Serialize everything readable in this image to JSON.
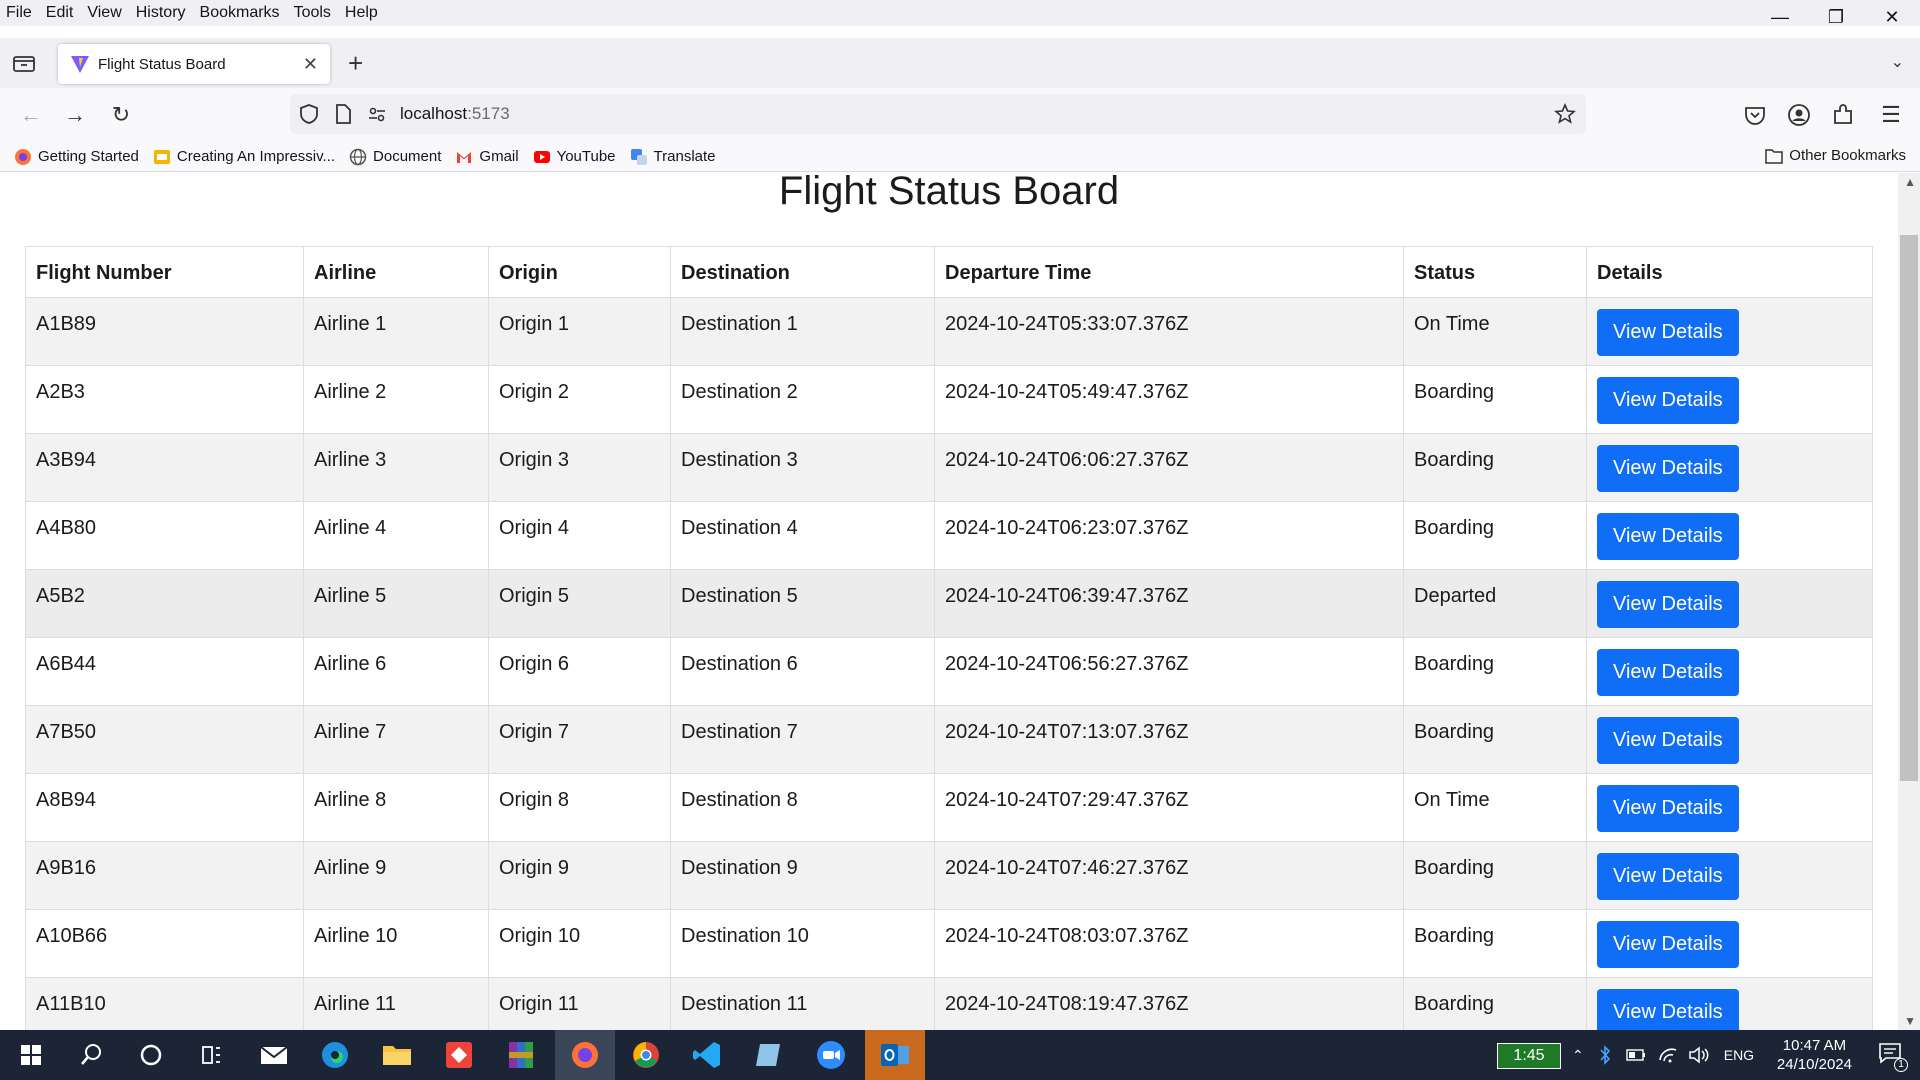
{
  "menu": [
    "File",
    "Edit",
    "View",
    "History",
    "Bookmarks",
    "Tools",
    "Help"
  ],
  "tab": {
    "title": "Flight Status Board",
    "close": "✕"
  },
  "url": {
    "host": "localhost",
    "port": ":5173"
  },
  "bookmarks": [
    {
      "label": "Getting Started",
      "color": "#ff7139"
    },
    {
      "label": "Creating An Impressiv...",
      "color": "#f4b400"
    },
    {
      "label": "Document",
      "color": "#555555"
    },
    {
      "label": "Gmail",
      "color": "#ea4335"
    },
    {
      "label": "YouTube",
      "color": "#ff0000"
    },
    {
      "label": "Translate",
      "color": "#4285f4"
    }
  ],
  "other_bookmarks": "Other Bookmarks",
  "page": {
    "title": "Flight Status Board",
    "columns": [
      "Flight Number",
      "Airline",
      "Origin",
      "Destination",
      "Departure Time",
      "Status",
      "Details"
    ],
    "button_label": "View Details",
    "rows": [
      {
        "flight": "A1B89",
        "airline": "Airline 1",
        "origin": "Origin 1",
        "destination": "Destination 1",
        "departure": "2024-10-24T05:33:07.376Z",
        "status": "On Time"
      },
      {
        "flight": "A2B3",
        "airline": "Airline 2",
        "origin": "Origin 2",
        "destination": "Destination 2",
        "departure": "2024-10-24T05:49:47.376Z",
        "status": "Boarding"
      },
      {
        "flight": "A3B94",
        "airline": "Airline 3",
        "origin": "Origin 3",
        "destination": "Destination 3",
        "departure": "2024-10-24T06:06:27.376Z",
        "status": "Boarding"
      },
      {
        "flight": "A4B80",
        "airline": "Airline 4",
        "origin": "Origin 4",
        "destination": "Destination 4",
        "departure": "2024-10-24T06:23:07.376Z",
        "status": "Boarding"
      },
      {
        "flight": "A5B2",
        "airline": "Airline 5",
        "origin": "Origin 5",
        "destination": "Destination 5",
        "departure": "2024-10-24T06:39:47.376Z",
        "status": "Departed"
      },
      {
        "flight": "A6B44",
        "airline": "Airline 6",
        "origin": "Origin 6",
        "destination": "Destination 6",
        "departure": "2024-10-24T06:56:27.376Z",
        "status": "Boarding"
      },
      {
        "flight": "A7B50",
        "airline": "Airline 7",
        "origin": "Origin 7",
        "destination": "Destination 7",
        "departure": "2024-10-24T07:13:07.376Z",
        "status": "Boarding"
      },
      {
        "flight": "A8B94",
        "airline": "Airline 8",
        "origin": "Origin 8",
        "destination": "Destination 8",
        "departure": "2024-10-24T07:29:47.376Z",
        "status": "On Time"
      },
      {
        "flight": "A9B16",
        "airline": "Airline 9",
        "origin": "Origin 9",
        "destination": "Destination 9",
        "departure": "2024-10-24T07:46:27.376Z",
        "status": "Boarding"
      },
      {
        "flight": "A10B66",
        "airline": "Airline 10",
        "origin": "Origin 10",
        "destination": "Destination 10",
        "departure": "2024-10-24T08:03:07.376Z",
        "status": "Boarding"
      },
      {
        "flight": "A11B10",
        "airline": "Airline 11",
        "origin": "Origin 11",
        "destination": "Destination 11",
        "departure": "2024-10-24T08:19:47.376Z",
        "status": "Boarding"
      }
    ]
  },
  "taskbar": {
    "battery_time": "1:45",
    "language": "ENG",
    "time": "10:47 AM",
    "date": "24/10/2024",
    "notifications": "1"
  },
  "colors": {
    "button_bg": "#0f6ef5",
    "taskbar_bg": "#1c2536"
  }
}
